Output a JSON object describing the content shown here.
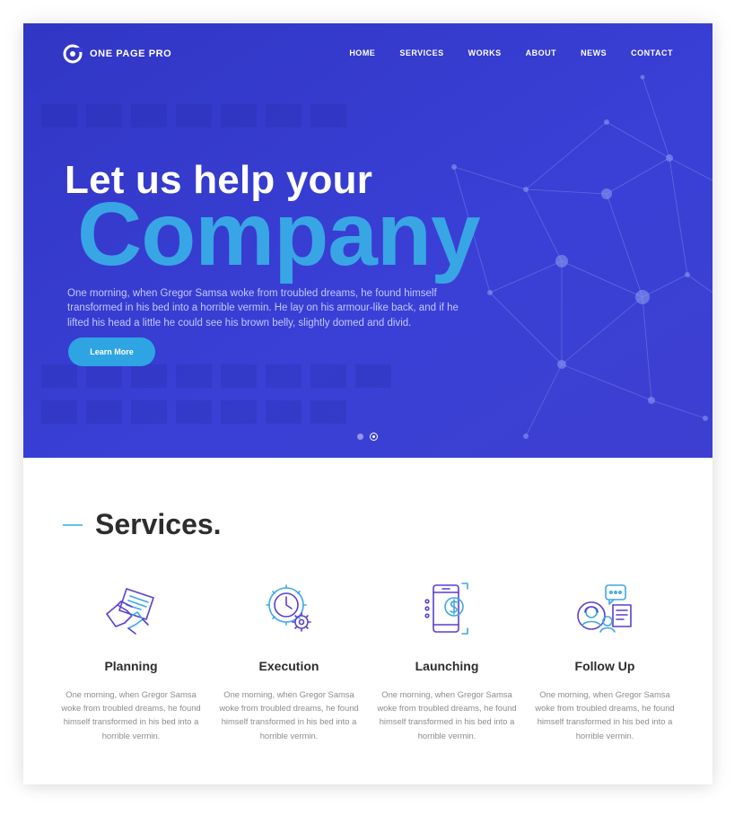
{
  "brand": {
    "name": "ONE PAGE PRO"
  },
  "nav": {
    "items": [
      "HOME",
      "SERVICES",
      "WORKS",
      "ABOUT",
      "NEWS",
      "CONTACT"
    ]
  },
  "hero": {
    "title_line1": "Let us help your",
    "title_line2": "Company",
    "text": "One morning, when Gregor Samsa woke from troubled dreams, he found himself transformed in his bed into a horrible vermin. He lay on his armour-like back, and if he lifted his head a little he could see his brown belly, slightly domed and divid.",
    "button_label": "Learn More",
    "slides": 2,
    "active_slide": 2
  },
  "services": {
    "title": "Services.",
    "items": [
      {
        "icon": "planning-icon",
        "title": "Planning",
        "text": "One morning, when Gregor Samsa woke from troubled dreams, he found himself transformed in his bed into a horrible vermin."
      },
      {
        "icon": "gear-clock-icon",
        "title": "Execution",
        "text": "One morning, when Gregor Samsa woke from troubled dreams, he found himself transformed in his bed into a horrible vermin."
      },
      {
        "icon": "mobile-payment-icon",
        "title": "Launching",
        "text": "One morning, when Gregor Samsa woke from troubled dreams, he found himself transformed in his bed into a horrible vermin."
      },
      {
        "icon": "support-chat-icon",
        "title": "Follow Up",
        "text": "One morning, when Gregor Samsa woke from troubled dreams, he found himself transformed in his bed into a horrible vermin."
      }
    ]
  },
  "colors": {
    "hero_bg": "#3a3fd2",
    "accent": "#38a6e4",
    "button": "#2fa4e3",
    "icon_purple": "#5a3fd0",
    "icon_blue": "#3fa7e6"
  }
}
